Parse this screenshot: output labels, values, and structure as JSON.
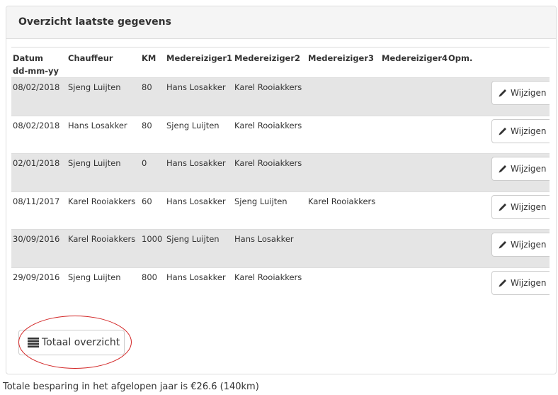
{
  "panel": {
    "title": "Overzicht laatste gegevens"
  },
  "table": {
    "headers": {
      "datum_line1": "Datum",
      "datum_line2": "dd-mm-yy",
      "chauffeur": "Chauffeur",
      "km": "KM",
      "m1": "Medereiziger1",
      "m2": "Medereiziger2",
      "m3": "Medereiziger3",
      "m4": "Medereiziger4",
      "opm": "Opm."
    },
    "rows": [
      {
        "datum": "08/02/2018",
        "chauffeur": "Sjeng Luijten",
        "km": "80",
        "m1": "Hans Losakker",
        "m2": "Karel Rooiakkers",
        "m3": "",
        "m4": "",
        "opm": ""
      },
      {
        "datum": "08/02/2018",
        "chauffeur": "Hans Losakker",
        "km": "80",
        "m1": "Sjeng Luijten",
        "m2": "Karel Rooiakkers",
        "m3": "",
        "m4": "",
        "opm": ""
      },
      {
        "datum": "02/01/2018",
        "chauffeur": "Sjeng Luijten",
        "km": "0",
        "m1": "Hans Losakker",
        "m2": "Karel Rooiakkers",
        "m3": "",
        "m4": "",
        "opm": ""
      },
      {
        "datum": "08/11/2017",
        "chauffeur": "Karel Rooiakkers",
        "km": "60",
        "m1": "Hans Losakker",
        "m2": "Sjeng Luijten",
        "m3": "Karel Rooiakkers",
        "m4": "",
        "opm": ""
      },
      {
        "datum": "30/09/2016",
        "chauffeur": "Karel Rooiakkers",
        "km": "1000",
        "m1": "Sjeng Luijten",
        "m2": "Hans Losakker",
        "m3": "",
        "m4": "",
        "opm": ""
      },
      {
        "datum": "29/09/2016",
        "chauffeur": "Sjeng Luijten",
        "km": "800",
        "m1": "Hans Losakker",
        "m2": "Karel Rooiakkers",
        "m3": "",
        "m4": "",
        "opm": ""
      }
    ],
    "edit_label": "Wijzigen",
    "edit_icon": "pencil-icon"
  },
  "total_button": {
    "label": "Totaal overzicht",
    "icon": "menu-icon"
  },
  "annotation": {
    "color": "#d22424"
  },
  "footer": {
    "text": "Totale besparing in het afgelopen jaar is €26.6 (140km)"
  }
}
